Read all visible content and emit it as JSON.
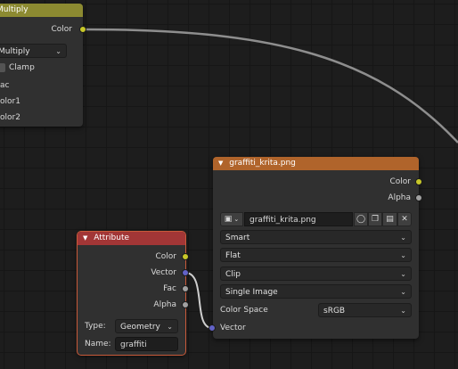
{
  "multiply_node": {
    "title": "Multiply",
    "output_label": "Color",
    "operation": "Multiply",
    "clamp_label": "Clamp",
    "inputs": [
      "ac",
      "olor1",
      "olor2"
    ]
  },
  "image_node": {
    "title": "graffiti_krita.png",
    "outputs": [
      "Color",
      "Alpha"
    ],
    "image_name": "graffiti_krita.png",
    "interpolation": "Smart",
    "projection": "Flat",
    "extension": "Clip",
    "source": "Single Image",
    "color_space_label": "Color Space",
    "color_space": "sRGB",
    "input_label": "Vector"
  },
  "attribute_node": {
    "title": "Attribute",
    "outputs": [
      "Color",
      "Vector",
      "Fac",
      "Alpha"
    ],
    "type_label": "Type:",
    "type_value": "Geometry",
    "name_label": "Name:",
    "name_value": "graffiti"
  },
  "colors": {
    "multiply_header": "#8c8a31",
    "image_header": "#b0642b",
    "attribute_header": "#a23636",
    "socket_color": "#c7c729",
    "socket_float": "#a1a1a1",
    "socket_vector": "#6363c7"
  }
}
